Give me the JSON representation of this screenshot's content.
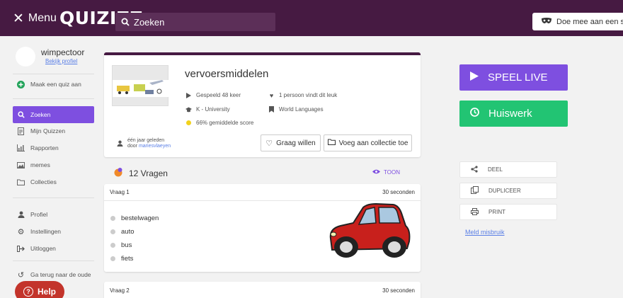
{
  "topbar": {
    "menu_label": "Menu",
    "logo": "QUIZIZZ",
    "search_label": "Zoeken",
    "join_label": "Doe mee aan een spel"
  },
  "sidebar": {
    "username": "wimpectoor",
    "profile_link": "Bekijk profiel",
    "create": "Maak een quiz aan",
    "items": [
      {
        "label": "Zoeken",
        "icon": "search-icon"
      },
      {
        "label": "Mijn Quizzen",
        "icon": "document-icon"
      },
      {
        "label": "Rapporten",
        "icon": "bar-chart-icon"
      },
      {
        "label": "memes",
        "icon": "image-icon"
      },
      {
        "label": "Collecties",
        "icon": "folder-icon"
      }
    ],
    "account": [
      {
        "label": "Profiel",
        "icon": "person-icon"
      },
      {
        "label": "Instellingen",
        "icon": "gear-icon"
      },
      {
        "label": "Uitloggen",
        "icon": "logout-icon"
      }
    ],
    "back_old": "Ga terug naar de oude",
    "help": "Help"
  },
  "quiz": {
    "title": "vervoersmiddelen",
    "played": "Gespeeld 48 keer",
    "likes": "1 persoon vindt dit leuk",
    "grade": "K - University",
    "subject": "World Languages",
    "score": "66% gemiddelde score",
    "author_time": "één jaar geleden",
    "author_by": "door",
    "author_name": "mariesvlaeyen",
    "like_button": "Graag willen",
    "collection_button": "Voeg aan collectie toe"
  },
  "questions": {
    "count_label": "12 Vragen",
    "show_label": "TOON",
    "items": [
      {
        "label": "Vraag 1",
        "time": "30 seconden",
        "answers": [
          "bestelwagen",
          "auto",
          "bus",
          "fiets"
        ]
      },
      {
        "label": "Vraag 2",
        "time": "30 seconden"
      }
    ]
  },
  "actions": {
    "play_live": "SPEEL LIVE",
    "homework": "Huiswerk",
    "share": "DEEL",
    "duplicate": "DUPLICEER",
    "print": "PRINT",
    "report": "Meld misbruik"
  },
  "colors": {
    "topbar": "#461a42",
    "accent_purple": "#7e4fe0",
    "homework_green": "#22c473",
    "help_red": "#c3342b"
  }
}
